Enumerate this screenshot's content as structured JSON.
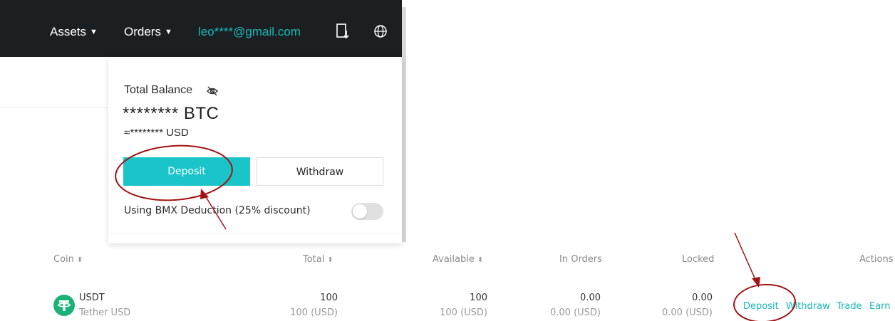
{
  "nav": {
    "assets": "Assets",
    "orders": "Orders",
    "caret": "▼",
    "email": "leo****@gmail.com"
  },
  "panel": {
    "total_balance_label": "Total Balance",
    "btc_amount": "******** BTC",
    "usd_amount": "≈******** USD",
    "deposit_label": "Deposit",
    "withdraw_label": "Withdraw",
    "deduction_label": "Using BMX Deduction (25% discount)",
    "deduction_enabled": false
  },
  "table": {
    "headers": {
      "coin": "Coin",
      "total": "Total",
      "available": "Available",
      "in_orders": "In Orders",
      "locked": "Locked",
      "actions": "Actions"
    },
    "sort_icon": "⬍",
    "rows": [
      {
        "symbol": "USDT",
        "name": "Tether USD",
        "total": "100",
        "total_usd": "100 (USD)",
        "available": "100",
        "available_usd": "100 (USD)",
        "in_orders": "0.00",
        "in_orders_usd": "0.00 (USD)",
        "locked": "0.00",
        "locked_usd": "0.00 (USD)",
        "actions": [
          "Deposit",
          "Withdraw",
          "Trade",
          "Earn"
        ]
      }
    ]
  },
  "colors": {
    "accent": "#19c5c8",
    "navbar": "#1c1f22",
    "annotation": "#a31212",
    "tether": "#1bb27a"
  }
}
